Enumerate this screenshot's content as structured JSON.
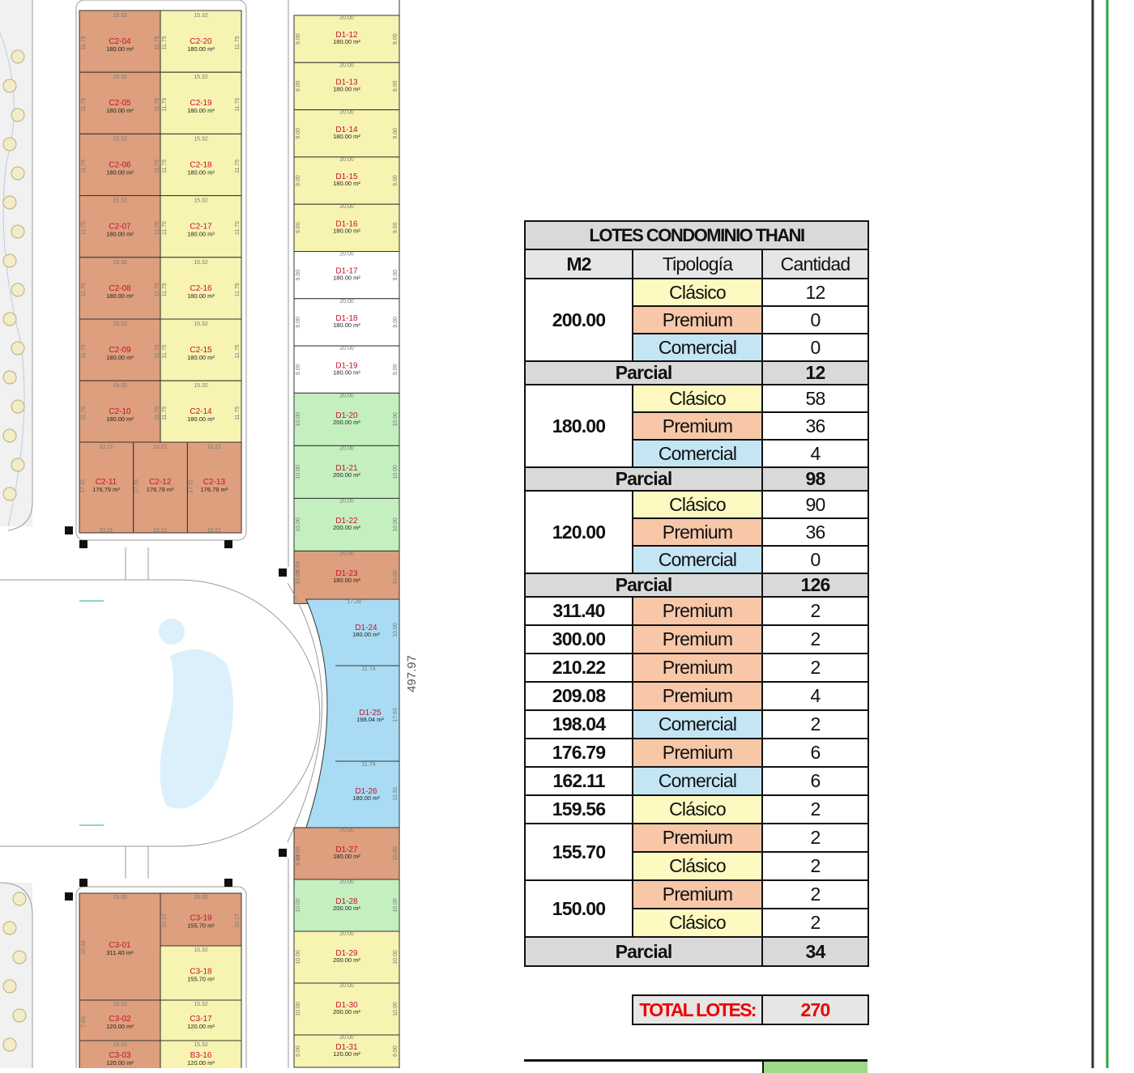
{
  "plan": {
    "lots_left": [
      {
        "code": "C2-04",
        "area": "180.00 m²",
        "color": "premium"
      },
      {
        "code": "C2-05",
        "area": "180.00 m²",
        "color": "premium"
      },
      {
        "code": "C2-06",
        "area": "180.00 m²",
        "color": "premium"
      },
      {
        "code": "C2-07",
        "area": "180.00 m²",
        "color": "premium"
      },
      {
        "code": "C2-08",
        "area": "180.00 m²",
        "color": "premium"
      },
      {
        "code": "C2-09",
        "area": "180.00 m²",
        "color": "premium"
      },
      {
        "code": "C2-10",
        "area": "180.00 m²",
        "color": "premium"
      }
    ],
    "lots_mid": [
      {
        "code": "C2-20",
        "area": "180.00 m²",
        "color": "clasico"
      },
      {
        "code": "C2-19",
        "area": "180.00 m²",
        "color": "clasico"
      },
      {
        "code": "C2-18",
        "area": "180.00 m²",
        "color": "clasico"
      },
      {
        "code": "C2-17",
        "area": "180.00 m²",
        "color": "clasico"
      },
      {
        "code": "C2-16",
        "area": "180.00 m²",
        "color": "clasico"
      },
      {
        "code": "C2-15",
        "area": "180.00 m²",
        "color": "clasico"
      },
      {
        "code": "C2-14",
        "area": "180.00 m²",
        "color": "clasico"
      }
    ],
    "lots_bottom_row": [
      {
        "code": "C2-11",
        "area": "176.79 m²"
      },
      {
        "code": "C2-12",
        "area": "176.79 m²"
      },
      {
        "code": "C2-13",
        "area": "176.79 m²"
      }
    ],
    "lots_d1": [
      {
        "code": "D1-12",
        "area": "180.00 m²",
        "color": "clasico",
        "side": "9.00"
      },
      {
        "code": "D1-13",
        "area": "180.00 m²",
        "color": "clasico",
        "side": "9.00"
      },
      {
        "code": "D1-14",
        "area": "180.00 m²",
        "color": "clasico",
        "side": "9.00"
      },
      {
        "code": "D1-15",
        "area": "180.00 m²",
        "color": "clasico",
        "side": "9.00"
      },
      {
        "code": "D1-16",
        "area": "180.00 m²",
        "color": "clasico",
        "side": "9.00"
      },
      {
        "code": "D1-17",
        "area": "180.00 m²",
        "color": "white",
        "side": "9.00"
      },
      {
        "code": "D1-18",
        "area": "180.00 m²",
        "color": "white",
        "side": "9.00"
      },
      {
        "code": "D1-19",
        "area": "180.00 m²",
        "color": "white",
        "side": "9.00"
      },
      {
        "code": "D1-20",
        "area": "200.00 m²",
        "color": "green",
        "side": "10.00"
      },
      {
        "code": "D1-21",
        "area": "200.00 m²",
        "color": "green",
        "side": "10.00"
      },
      {
        "code": "D1-22",
        "area": "200.00 m²",
        "color": "green",
        "side": "10.00"
      },
      {
        "code": "D1-23",
        "area": "180.00 m²",
        "color": "premium",
        "side": "10.00"
      }
    ],
    "lots_d1_curve": [
      {
        "code": "D1-24",
        "area": "180.00 m²",
        "side": "10.00"
      },
      {
        "code": "D1-25",
        "area": "198.04 m²",
        "side": "17.93"
      },
      {
        "code": "D1-26",
        "area": "180.00 m²",
        "side": "12.81"
      }
    ],
    "lots_d1_lower": [
      {
        "code": "D1-27",
        "area": "180.00 m²",
        "color": "premium",
        "side": "10.00"
      },
      {
        "code": "D1-28",
        "area": "200.00 m²",
        "color": "green",
        "side": "10.00"
      },
      {
        "code": "D1-29",
        "area": "200.00 m²",
        "color": "clasico",
        "side": "10.00"
      },
      {
        "code": "D1-30",
        "area": "200.00 m²",
        "color": "clasico",
        "side": "10.00"
      },
      {
        "code": "D1-31",
        "area": "120.00 m²",
        "color": "clasico",
        "side": "6.00"
      }
    ],
    "lots_c3": [
      {
        "code": "C3-01",
        "area": "311.40 m²"
      },
      {
        "code": "C3-19",
        "area": "155.70 m²"
      },
      {
        "code": "C3-18",
        "area": "155.70 m²"
      },
      {
        "code": "C3-02",
        "area": "120.00 m²"
      },
      {
        "code": "C3-17",
        "area": "120.00 m²"
      },
      {
        "code": "C3-03",
        "area": "120.00 m²"
      },
      {
        "code": "B3-16",
        "area": "120.00 m²"
      }
    ],
    "dims": {
      "w1532": "15.32",
      "h1175": "11.75",
      "w1021": "10.21",
      "h1731": "17.31",
      "w2000": "20.00",
      "w1728": "17.28",
      "w1174": "11.74",
      "h564": "5.64",
      "h2033": "20.33",
      "h1017": "10.17",
      "h783": "7.83",
      "total": "497.97"
    },
    "colors": {
      "premium": "#dd9f7d",
      "clasico": "#f7f3b1",
      "green": "#c4f0bf",
      "comercial": "#a9dcf4",
      "white": "#ffffff"
    }
  },
  "table": {
    "title": "LOTES CONDOMINIO THANI",
    "headers": [
      "M2",
      "Tipología",
      "Cantidad"
    ],
    "groups": [
      {
        "m2": "200.00",
        "rows": [
          [
            "Clásico",
            "12"
          ],
          [
            "Premium",
            "0"
          ],
          [
            "Comercial",
            "0"
          ]
        ],
        "parcial_label": "Parcial",
        "parcial": "12"
      },
      {
        "m2": "180.00",
        "rows": [
          [
            "Clásico",
            "58"
          ],
          [
            "Premium",
            "36"
          ],
          [
            "Comercial",
            "4"
          ]
        ],
        "parcial_label": "Parcial",
        "parcial": "98"
      },
      {
        "m2": "120.00",
        "rows": [
          [
            "Clásico",
            "90"
          ],
          [
            "Premium",
            "36"
          ],
          [
            "Comercial",
            "0"
          ]
        ],
        "parcial_label": "Parcial",
        "parcial": "126"
      }
    ],
    "singles": [
      {
        "m2": "311.40",
        "tipo": "Premium",
        "qty": "2"
      },
      {
        "m2": "300.00",
        "tipo": "Premium",
        "qty": "2"
      },
      {
        "m2": "210.22",
        "tipo": "Premium",
        "qty": "2"
      },
      {
        "m2": "209.08",
        "tipo": "Premium",
        "qty": "4"
      },
      {
        "m2": "198.04",
        "tipo": "Comercial",
        "qty": "2"
      },
      {
        "m2": "176.79",
        "tipo": "Premium",
        "qty": "6"
      },
      {
        "m2": "162.11",
        "tipo": "Comercial",
        "qty": "6"
      },
      {
        "m2": "159.56",
        "tipo": "Clásico",
        "qty": "2"
      }
    ],
    "pairs": [
      {
        "m2": "155.70",
        "rows": [
          [
            "Premium",
            "2"
          ],
          [
            "Clásico",
            "2"
          ]
        ]
      },
      {
        "m2": "150.00",
        "rows": [
          [
            "Premium",
            "2"
          ],
          [
            "Clásico",
            "2"
          ]
        ]
      }
    ],
    "parcial_final_label": "Parcial",
    "parcial_final": "34",
    "total_label": "TOTAL LOTES:",
    "total": "270"
  }
}
